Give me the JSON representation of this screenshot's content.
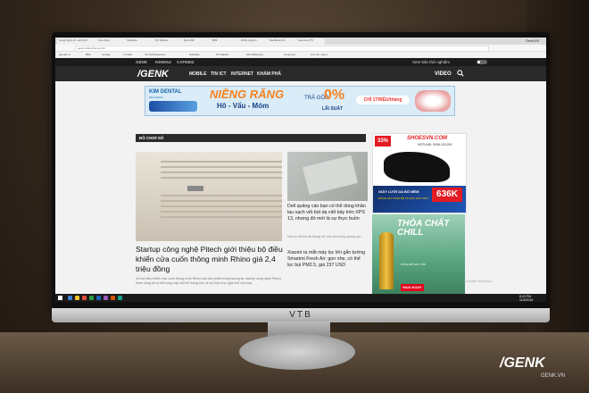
{
  "browser": {
    "tabs": [
      "Công nghệ số - Đồ chơi",
      "Các dòng",
      "Software",
      "PC Market",
      "Dell ANP",
      "BMI",
      "2016 Autumn",
      "MacBook Pro",
      "Samsung TV"
    ],
    "user": "GenkVN",
    "url": "genk.vn/do-choi-so.chn",
    "bookmarks": [
      "gamek.vn",
      "BMI",
      "Google",
      "Từ điển",
      "VN TechNewsxml",
      "Software",
      "PC Market",
      "MC Marketing",
      "Công việc",
      "An ninh mạng"
    ]
  },
  "site": {
    "top_links": [
      "GENK",
      "KENH14",
      "CAFEBIZ"
    ],
    "toggle_label": "Xem bản thử nghiệm",
    "logo": "/GENK",
    "nav": [
      "MOBILE",
      "TIN ICT",
      "INTERNET",
      "KHÁM PHÁ"
    ],
    "video_label": "VIDEO"
  },
  "banner": {
    "brand": "KIM DENTAL",
    "brand_sub": "NHA KHOA",
    "headline": "NIỀNG RĂNG",
    "subline": "Hô - Vẩu - Móm",
    "installment": "TRẢ GÓP",
    "rate": "0%",
    "rate_label": "LÃI SUẤT",
    "offer": "CHỈ 1TRIỆU/tháng"
  },
  "section": {
    "title": "ĐỒ CHƠI SỐ"
  },
  "articles": {
    "main": {
      "title": "Startup công nghệ Pitech giới thiệu bộ điều khiển cửa cuốn thông minh Rhino giá 2,4 triệu đồng",
      "desc": "Với bộ điều khiển cửa cuốn thông minh Rhino của sản phẩm trong tương lai, startup công nghệ Pitech tham vọng sẽ có thể cung cấp một hệ thống bảo vệ an toàn cho ngôi nhà của bạn."
    },
    "side": {
      "title": "Dell quảng cáo bạn có thể dùng khăn lau sạch vết bút dạ viết bảy trên XPS 13, nhưng đó mới là sự thực buồn",
      "desc": "Hóa ra vết bút dạ không dễ xóa như trong quảng cáo."
    },
    "sub": {
      "title": "Xiaomi ra mắt máy lọc khí gắn tường Smartmi Fresh Air: gọn nhẹ, có thể lọc bụi PM2.5, giá 237 USD"
    }
  },
  "ads": {
    "shoe": {
      "discount": "33%",
      "brand": "SHOESVN.COM",
      "phone": "HOTLINE: 0936.229.252",
      "product": "GIÀY LƯỜI DA BÒ MỀM",
      "tagline": "ĐỒNG GIÁ TOÀN BỘ 16 MẪU GIÀY MỚI",
      "price": "636K"
    },
    "beer": {
      "headline": "THỎA CHẤT CHILL",
      "sub": "CÙNG BỘ SƯU TẬP",
      "cta": "MUA NGAY"
    }
  },
  "os": {
    "watermark": "Activate Windows",
    "time": "8:33 PM",
    "date": "11/6/2016"
  },
  "monitor": {
    "brand": "VTB"
  },
  "photo_watermark": {
    "logo": "/GENK",
    "url": "GENK.VN"
  }
}
